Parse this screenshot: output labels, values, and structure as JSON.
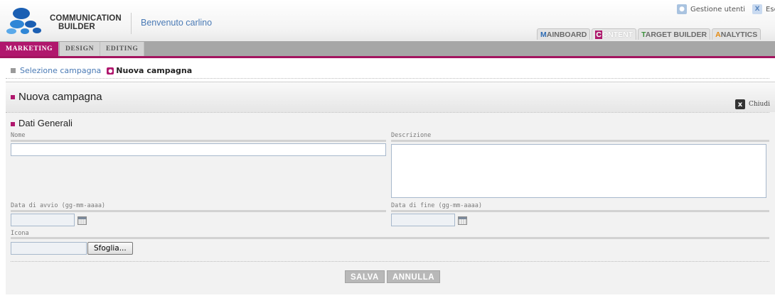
{
  "header": {
    "brand_line1": "COMMUNICATION",
    "brand_line2": "BUILDER",
    "welcome": "Benvenuto carlino",
    "manage_users": "Gestione utenti",
    "logout": "Esci"
  },
  "app_tabs": [
    {
      "cap": "M",
      "rest": "AINBOARD",
      "active": false
    },
    {
      "cap": "C",
      "rest": "ONTENT",
      "active": true
    },
    {
      "cap": "T",
      "rest": "ARGET BUILDER",
      "active": false
    },
    {
      "cap": "A",
      "rest": "NALYTICS",
      "active": false
    }
  ],
  "sub_tabs": [
    "MARKETING",
    "DESIGN",
    "EDITING"
  ],
  "breadcrumb": {
    "link": "Selezione campagna",
    "current": "Nuova campagna"
  },
  "panel": {
    "title": "Nuova campagna",
    "close_label": "Chiudi",
    "section": "Dati Generali"
  },
  "form": {
    "name_label": "Nome",
    "name_value": "",
    "description_label": "Descrizione",
    "description_value": "",
    "start_label": "Data di avvio (gg-mm-aaaa)",
    "start_value": "",
    "end_label": "Data di fine (gg-mm-aaaa)",
    "end_value": "",
    "icon_label": "Icona",
    "icon_value": "",
    "browse_label": "Sfoglia...",
    "save_label": "SALVA",
    "cancel_label": "ANNULLA"
  },
  "colors": {
    "accent": "#b0176d",
    "link": "#4a7ab5",
    "subnav": "#a6a6a6"
  }
}
